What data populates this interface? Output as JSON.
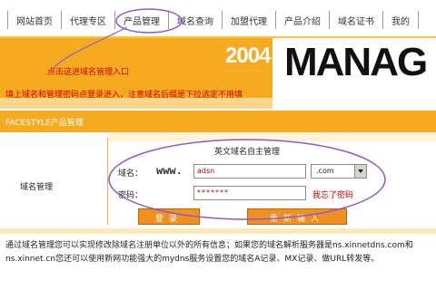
{
  "nav": {
    "items": [
      {
        "label": "网站首页"
      },
      {
        "label": "代理专区"
      },
      {
        "label": "产品管理"
      },
      {
        "label": "域名查询"
      },
      {
        "label": "加盟代理"
      },
      {
        "label": "产品介绍"
      },
      {
        "label": "域名证书"
      },
      {
        "label": "我的"
      }
    ],
    "active_index": 2
  },
  "banner": {
    "year": "2004",
    "subtitle": "...............",
    "word": "MANAG"
  },
  "annotations": {
    "step1": "点击这进域名管理入口",
    "step2": "填上域名和管理密码点登录进入，注意域名后缀是下拉选定不用填"
  },
  "section": {
    "title": "FACESTYLE产品管理",
    "side_label": "域名管理"
  },
  "form": {
    "title": "英文域名自主管理",
    "domain_label": "域名：",
    "prefix": "www.",
    "domain_value": "adsn",
    "suffix_selected": ".com",
    "password_label": "密码：",
    "password_value": "*******",
    "forgot_link": "我忘了密码",
    "login_button": "登录",
    "reset_button": "重新输入"
  },
  "info": {
    "text": "通过域名管理您可以实现修改除域名注册单位以外的所有信息；如果您的域名解析服务器是ns.xinnetdns.com和ns.xinnet.cn您还可以使用新网功能强大的mydns服务设置您的域名A记录、MX记录、做URL转发等。"
  },
  "colors": {
    "accent_orange": "#f6aa1f",
    "annotation_red": "#cc0000",
    "annotation_ellipse": "#8a5ad0"
  }
}
